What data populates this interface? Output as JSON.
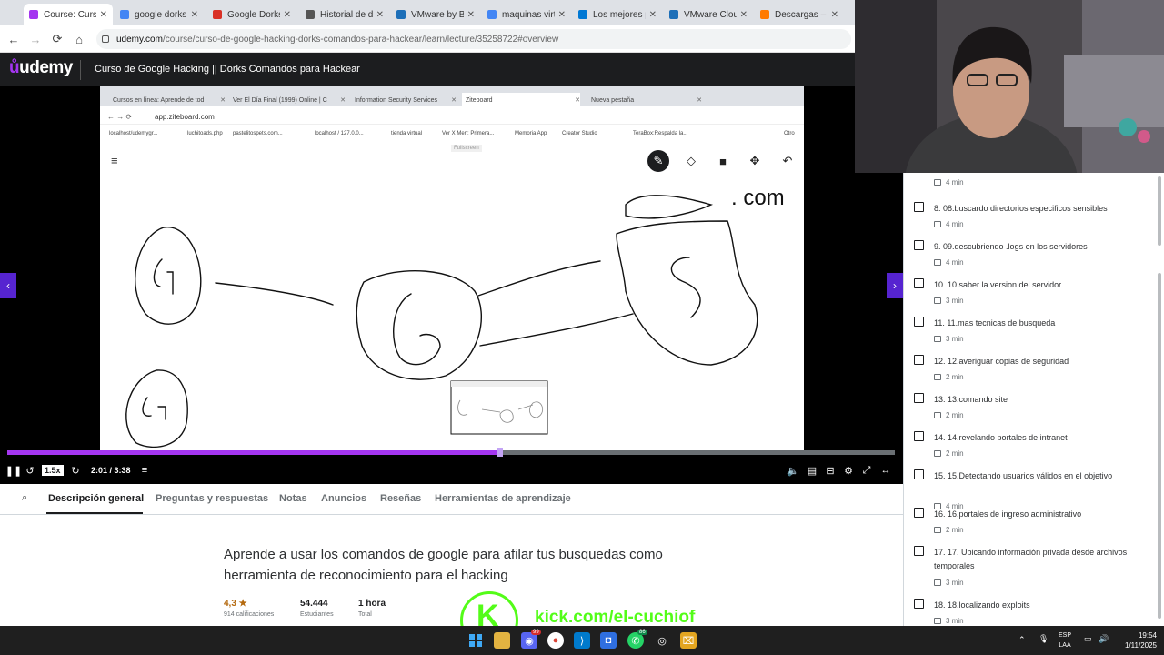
{
  "browser": {
    "tabs": [
      {
        "label": "Course: Curso",
        "color": "#a435f0",
        "active": true
      },
      {
        "label": "google dorks",
        "color": "#4285f4",
        "active": false
      },
      {
        "label": "Google Dorks",
        "color": "#d93025",
        "active": false
      },
      {
        "label": "Historial de de",
        "color": "#555555",
        "active": false
      },
      {
        "label": "VMware by Bro",
        "color": "#1d6fb8",
        "active": false
      },
      {
        "label": "maquinas virtu",
        "color": "#4285f4",
        "active": false
      },
      {
        "label": "Los mejores p",
        "color": "#0078d4",
        "active": false
      },
      {
        "label": "VMware Cloud",
        "color": "#1d6fb8",
        "active": false
      },
      {
        "label": "Descargas – O",
        "color": "#ff7a00",
        "active": false
      }
    ],
    "url_domain": "udemy.com",
    "url_path": "/course/curso-de-google-hacking-dorks-comandos-para-hackear/learn/lecture/35258722#overview"
  },
  "header": {
    "logo": "udemy",
    "course_title": "Curso de Google Hacking || Dorks Comandos para Hackear"
  },
  "video": {
    "inner_tabs": [
      {
        "label": "Cursos en línea: Aprende de tod"
      },
      {
        "label": "Ver El Día Final (1999) Online | C"
      },
      {
        "label": "Information Security Services"
      },
      {
        "label": "Ziteboard"
      },
      {
        "label": "Nueva pestaña"
      }
    ],
    "inner_url": "app.ziteboard.com",
    "bookmarks": [
      "localhost/udemygr...",
      "luchitoads.php",
      "pastelitospets.com...",
      "localhost / 127.0.0...",
      "tienda virtual",
      "Ver X Men: Primera...",
      "Memoria App",
      "Creator Studio",
      "TeraBox:Respalda la...",
      "Otro"
    ],
    "fullscreen_hint": "Fullscreen",
    "whiteboard_text": ". com"
  },
  "player": {
    "rate": "1.5x",
    "time": "2:01 / 3:38",
    "progress": 0.555
  },
  "tabs": {
    "items": [
      "Descripción general",
      "Preguntas y respuestas",
      "Notas",
      "Anuncios",
      "Reseñas",
      "Herramientas de aprendizaje"
    ]
  },
  "overview": {
    "description": "Aprende a usar los comandos de google para afilar tus busquedas como herramienta de reconocimiento para el hacking",
    "rating": "4,3 ★",
    "rating_label": "914 calificaciones",
    "students": "54.444",
    "students_label": "Estudiantes",
    "total": "1 hora",
    "total_label": "Total"
  },
  "kick": {
    "letter": "K",
    "text": "kick.com/el-cuchiof"
  },
  "sidebar": {
    "first_duration": "4 min",
    "lectures": [
      {
        "title": "8. 08.buscardo directorios especificos sensibles",
        "duration": "4 min"
      },
      {
        "title": "9. 09.descubriendo .logs en los servidores",
        "duration": "4 min"
      },
      {
        "title": "10. 10.saber la version del servidor",
        "duration": "3 min"
      },
      {
        "title": "11. 11.mas tecnicas de busqueda",
        "duration": "3 min"
      },
      {
        "title": "12. 12.averiguar copias de seguridad",
        "duration": "2 min"
      },
      {
        "title": "13. 13.comando site",
        "duration": "2 min"
      },
      {
        "title": "14. 14.revelando portales de intranet",
        "duration": "2 min"
      },
      {
        "title": "15. 15.Detectando usuarios válidos en el objetivo",
        "duration": "4 min"
      },
      {
        "title": "16. 16.portales de ingreso administrativo",
        "duration": "2 min"
      },
      {
        "title": "17. 17. Ubicando información privada desde archivos temporales",
        "duration": "3 min"
      },
      {
        "title": "18. 18.localizando exploits",
        "duration": "3 min"
      }
    ]
  },
  "taskbar": {
    "lang_top": "ESP",
    "lang_bottom": "LAA",
    "time": "19:54",
    "date": "1/11/2025",
    "badge_discord": "99",
    "badge_whatsapp": "86"
  }
}
